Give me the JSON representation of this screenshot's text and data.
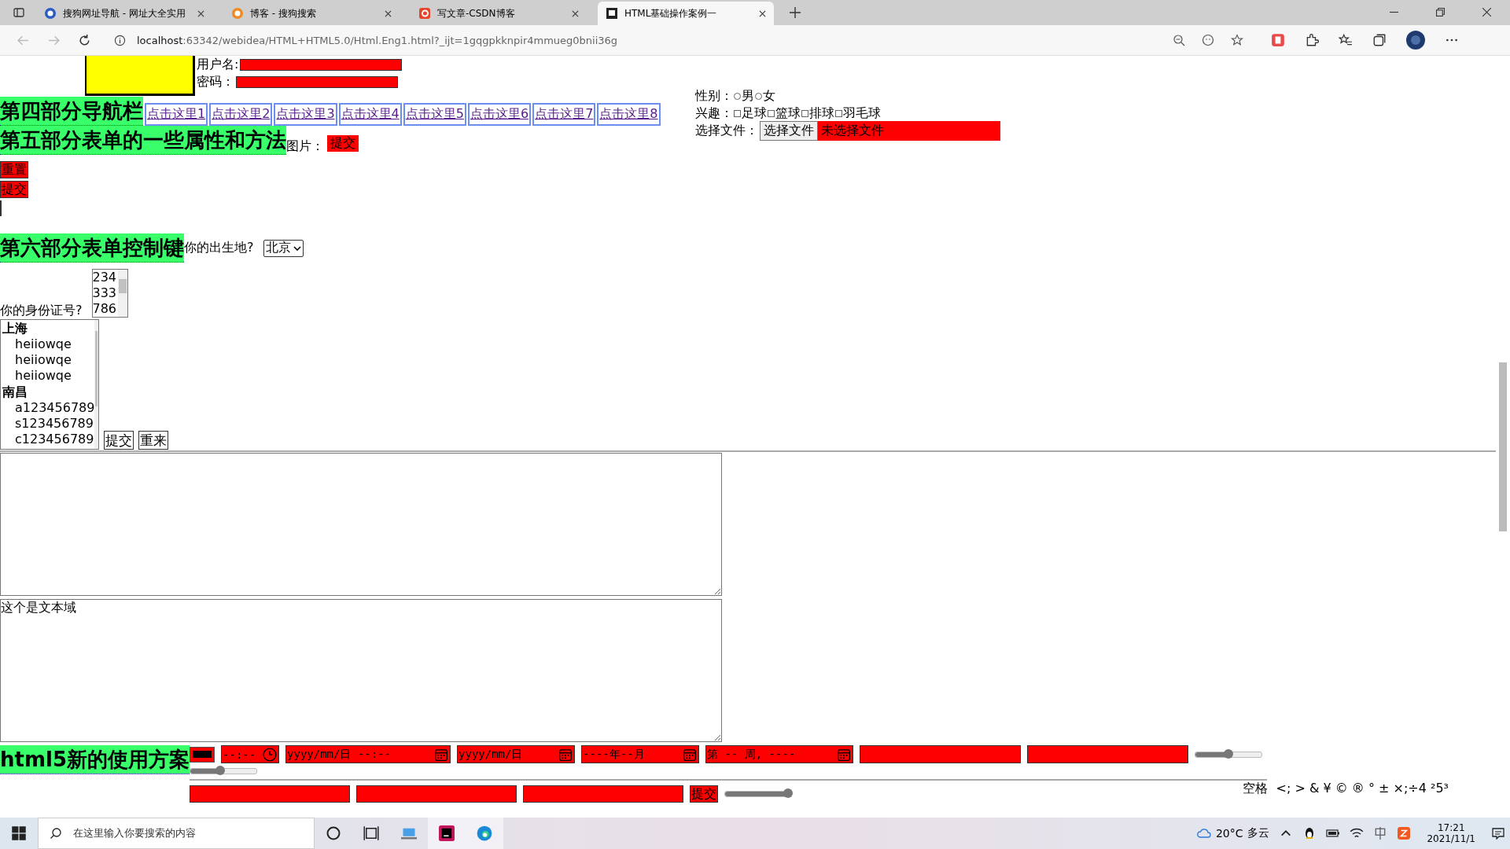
{
  "browser": {
    "tabs": [
      {
        "title": "搜狗网址导航 - 网址大全实用",
        "selected": false
      },
      {
        "title": "博客 - 搜狗搜索",
        "selected": false
      },
      {
        "title": "写文章-CSDN博客",
        "selected": false
      },
      {
        "title": "HTML基础操作案例一",
        "selected": true
      }
    ],
    "address_host": "localhost",
    "address_rest": ":63342/webidea/HTML+HTML5.0/Html.Eng1.html?_ijt=1gqgpkknpir4mmueg0bnii36g"
  },
  "page": {
    "login": {
      "username_label": "用户名:",
      "password_label": "密码："
    },
    "gender": {
      "label": "性别：",
      "options": [
        {
          "label": "男",
          "selected": false
        },
        {
          "label": "女",
          "selected": false
        }
      ]
    },
    "hobbies": {
      "label": "兴趣：",
      "options": [
        {
          "label": "足球",
          "checked": false
        },
        {
          "label": "篮球",
          "checked": false
        },
        {
          "label": "排球",
          "checked": false
        },
        {
          "label": "羽毛球",
          "checked": false
        }
      ]
    },
    "file": {
      "label": "选择文件：",
      "button": "选择文件",
      "status": "未选择文件"
    },
    "nav": {
      "heading": "第四部分导航栏",
      "links": [
        "点击这里1",
        "点击这里2",
        "点击这里3",
        "点击这里4",
        "点击这里5",
        "点击这里6",
        "点击这里7",
        "点击这里8"
      ]
    },
    "form_methods": {
      "heading": "第五部分表单的一些属性和方法",
      "image_label": "图片：",
      "image_alt": "提交",
      "buttons": [
        "重置",
        "提交"
      ]
    },
    "controls": {
      "heading": "第六部分表单控制键",
      "birthplace_label": "你的出生地?",
      "birthplace_value": "北京",
      "id_label": "你的身份证号?",
      "id_options": [
        "234",
        "333",
        "786"
      ],
      "groups": [
        {
          "label": "上海",
          "options": [
            "heiiowqe",
            "heiiowqe",
            "heiiowqe"
          ]
        },
        {
          "label": "南昌",
          "options": [
            "a123456789",
            "s123456789",
            "c123456789"
          ]
        }
      ],
      "buttons": [
        "提交",
        "重来"
      ]
    },
    "textarea_2": "这个是文本域",
    "html5": {
      "heading": "html5新的使用方案",
      "inputs_1": [
        {
          "kind": "color"
        },
        {
          "kind": "time",
          "placeholder": "--:--"
        },
        {
          "kind": "datetime",
          "placeholder": "yyyy/mm/日 --:--"
        },
        {
          "kind": "date",
          "placeholder": "yyyy/mm/日"
        },
        {
          "kind": "month",
          "placeholder": "----年--月"
        },
        {
          "kind": "week",
          "placeholder": "第 -- 周, ----"
        },
        {
          "kind": "text"
        },
        {
          "kind": "text"
        },
        {
          "kind": "range",
          "level": 0.5
        },
        {
          "kind": "range",
          "level": 0.45
        }
      ],
      "inputs_2": [
        {
          "kind": "text"
        },
        {
          "kind": "text"
        },
        {
          "kind": "text"
        },
        {
          "kind": "submit",
          "label": "提交"
        },
        {
          "kind": "range",
          "level": 0.95
        }
      ],
      "entities": "空格  <; > & ¥ © ® ° ± ×;÷4 ²5³"
    }
  },
  "taskbar": {
    "search_placeholder": "在这里输入你要搜索的内容",
    "temperature": "20°C",
    "weather": "多云",
    "time": "17:21",
    "date": "2021/11/1"
  }
}
